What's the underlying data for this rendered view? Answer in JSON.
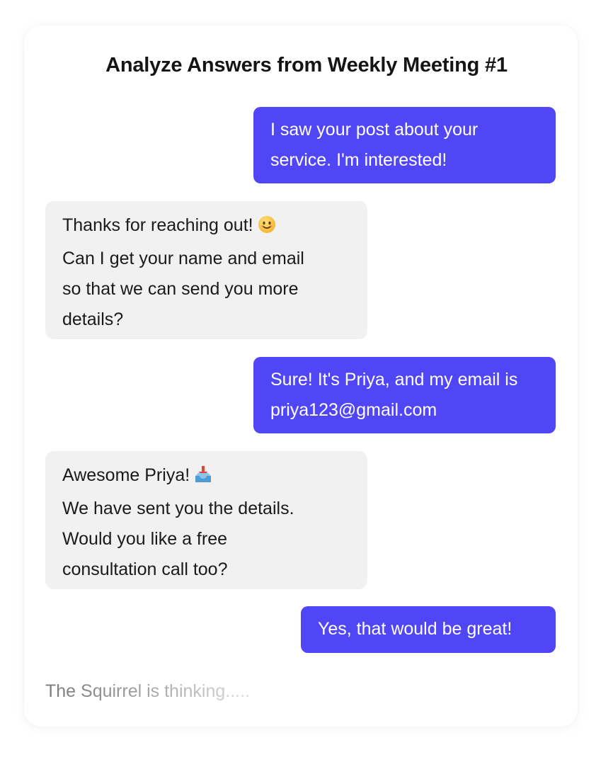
{
  "chat": {
    "title": "Analyze Answers from Weekly Meeting #1",
    "messages": [
      {
        "sender": "user",
        "text": "I saw your post about your\nservice. I'm interested!"
      },
      {
        "sender": "bot",
        "line1": "Thanks for reaching out!",
        "line1_emoji": "smiling-face-emoji",
        "rest": "Can I get your name and email\nso that we can send you more\ndetails?"
      },
      {
        "sender": "user",
        "text": "Sure! It's Priya, and my email is\npriya123@gmail.com"
      },
      {
        "sender": "bot",
        "line1": "Awesome Priya!",
        "line1_emoji": "inbox-tray-emoji",
        "rest": "We have sent you the details.\nWould you like a free\nconsultation call too?"
      },
      {
        "sender": "user",
        "text": "Yes, that would be great!"
      }
    ],
    "status_text": "The Squirrel is thinking.....",
    "colors": {
      "user_bubble": "#5046F5",
      "bot_bubble": "#F1F1F1",
      "title_text": "#151515",
      "status_text": "#8A8A8A"
    }
  }
}
